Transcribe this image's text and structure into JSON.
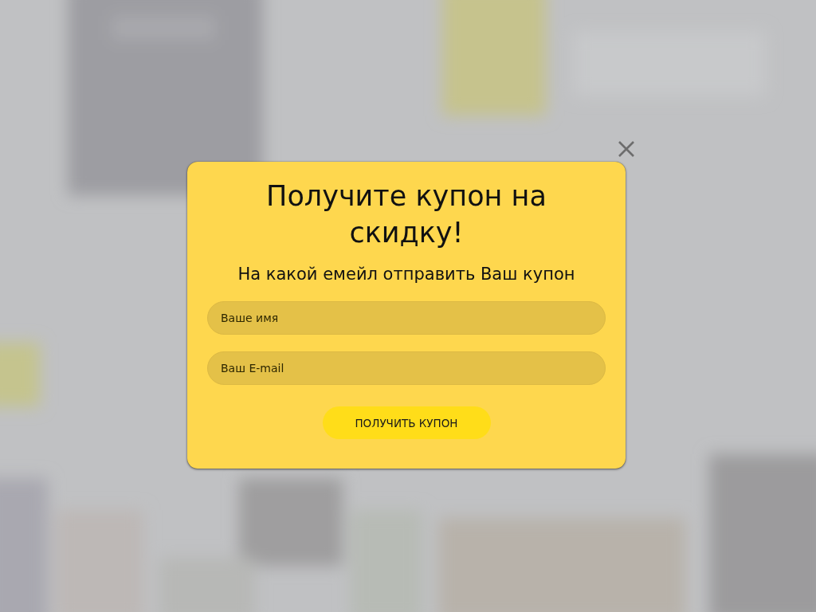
{
  "popup": {
    "title": "Получите купон на скидку!",
    "subtitle": "На какой емейл отправить Ваш купон",
    "fields": [
      {
        "placeholder": "Ваше имя"
      },
      {
        "placeholder": "Ваш E-mail"
      }
    ],
    "submit_button": "ПОЛУЧИТЬ КУПОН"
  }
}
